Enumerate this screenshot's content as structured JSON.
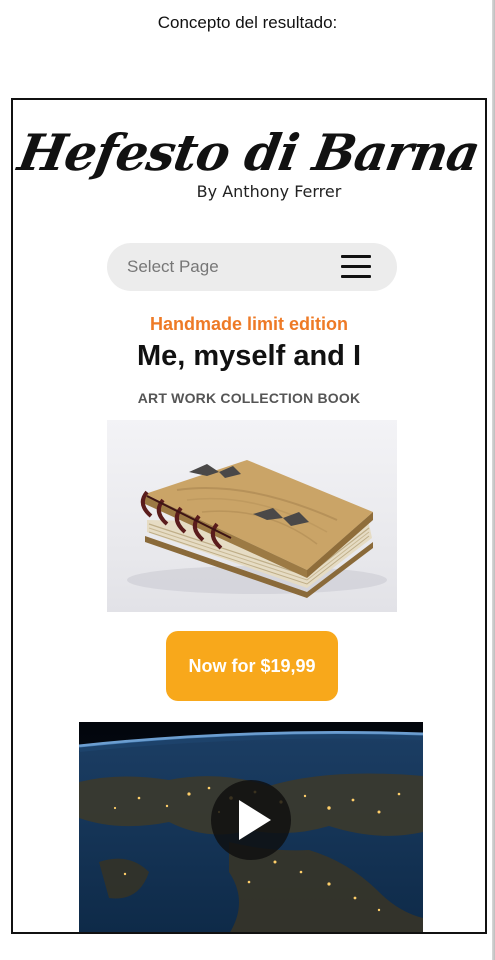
{
  "caption": "Concepto del resultado:",
  "brand": {
    "name": "Hefesto di Barna",
    "byline": "By Anthony Ferrer"
  },
  "nav": {
    "label": "Select Page",
    "icon": "hamburger-menu-icon"
  },
  "hero": {
    "tagline": "Handmade limit edition",
    "title": "Me, myself and I",
    "subtitle": "ART WORK COLLECTION BOOK"
  },
  "cta": {
    "label": "Now for $19,99"
  },
  "video": {
    "icon": "play-icon"
  },
  "colors": {
    "accent_orange": "#ee7a26",
    "button_yellow": "#f8a81b",
    "nav_bg": "#ececec"
  }
}
